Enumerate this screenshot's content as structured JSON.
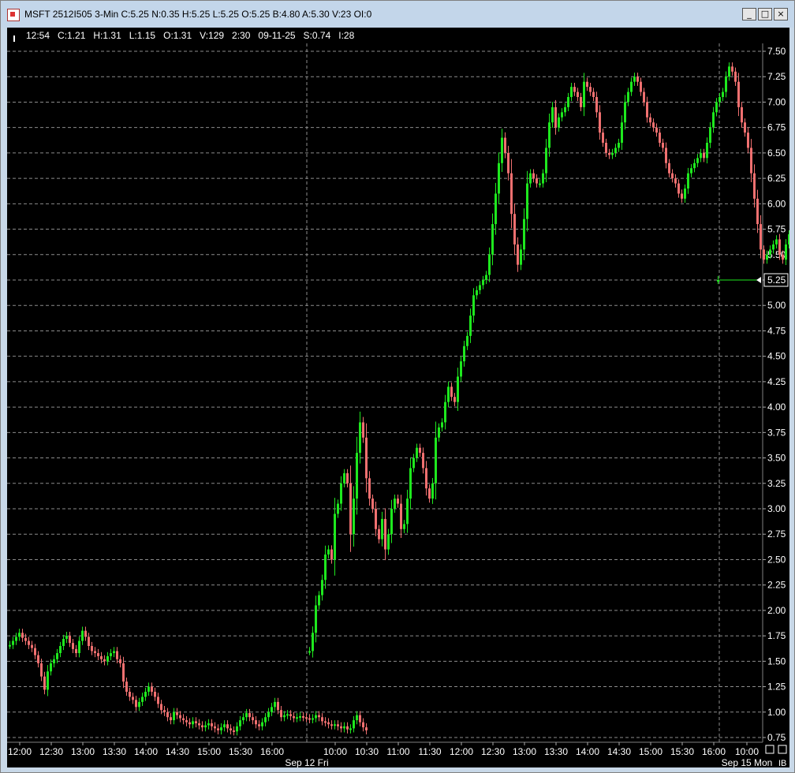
{
  "window": {
    "title": "MSFT 2512I505 3-Min C:5.25 N:0.35 H:5.25 L:5.25 O:5.25 B:4.80 A:5.30 V:23 OI:0",
    "buttons": [
      "_",
      "□",
      "×"
    ]
  },
  "info_bar": {
    "text": "12:54   C:1.21   H:1.31   L:1.15   O:1.31   V:129   2:30   09-11-25   S:0.74   I:28"
  },
  "colors": {
    "up": "#1ee81e",
    "down": "#f07070",
    "grid": "#8c8c8c",
    "axis_text": "#ffffff",
    "background": "#000000"
  },
  "chart_data": {
    "type": "candlestick",
    "y_ticks": [
      "7.50",
      "7.25",
      "7.00",
      "6.75",
      "6.50",
      "6.25",
      "6.00",
      "5.75",
      "5.50",
      "5.25",
      "5.00",
      "4.75",
      "4.50",
      "4.25",
      "4.00",
      "3.75",
      "3.50",
      "3.25",
      "3.00",
      "2.75",
      "2.50",
      "2.25",
      "2.00",
      "1.75",
      "1.50",
      "1.25",
      "1.00",
      "0.75"
    ],
    "ylim": [
      0.75,
      7.5
    ],
    "last_price_label": "5.25",
    "x_ticks": [
      "12:00",
      "12:30",
      "13:00",
      "13:30",
      "14:00",
      "14:30",
      "15:00",
      "15:30",
      "16:00",
      "10:00",
      "10:30",
      "11:00",
      "11:30",
      "12:00",
      "12:30",
      "13:00",
      "13:30",
      "14:00",
      "14:30",
      "15:00",
      "15:30",
      "16:00",
      "10:00"
    ],
    "date_labels": [
      "Sep 12 Fri",
      "Sep 15 Mon"
    ],
    "corner_label": "IB",
    "sessions": [
      {
        "label": "Sep 11",
        "start": "11:48",
        "bar_minutes": 3,
        "close": [
          1.66,
          1.7,
          1.74,
          1.78,
          1.73,
          1.7,
          1.66,
          1.63,
          1.56,
          1.48,
          1.35,
          1.22,
          1.4,
          1.48,
          1.52,
          1.58,
          1.65,
          1.72,
          1.75,
          1.68,
          1.62,
          1.58,
          1.7,
          1.8,
          1.74,
          1.65,
          1.6,
          1.58,
          1.55,
          1.52,
          1.5,
          1.55,
          1.58,
          1.6,
          1.52,
          1.48,
          1.3,
          1.2,
          1.15,
          1.12,
          1.05,
          1.1,
          1.15,
          1.2,
          1.25,
          1.2,
          1.15,
          1.08,
          1.02,
          1.0,
          0.95,
          0.92,
          1.0,
          0.97,
          0.94,
          0.92,
          0.9,
          0.88,
          0.91,
          0.89,
          0.87,
          0.85,
          0.87,
          0.89,
          0.86,
          0.84,
          0.82,
          0.85,
          0.88,
          0.84,
          0.82,
          0.81,
          0.86,
          0.92,
          0.95,
          0.99,
          0.95,
          0.92,
          0.88,
          0.86,
          0.9,
          0.95,
          1.0,
          1.05,
          1.1,
          1.02,
          0.95,
          0.97,
          0.98,
          0.96,
          0.94,
          0.95,
          0.96,
          0.95,
          0.94,
          0.93,
          0.94,
          0.97,
          0.95,
          0.91,
          0.9,
          0.88,
          0.87,
          0.88,
          0.86,
          0.84,
          0.86,
          0.83,
          0.84,
          0.92,
          0.97,
          0.9,
          0.85,
          0.82
        ]
      },
      {
        "label": "Sep 12 Fri",
        "start": "09:33",
        "bar_minutes": 3,
        "close": [
          1.6,
          1.78,
          2.05,
          2.15,
          2.3,
          2.55,
          2.6,
          2.5,
          2.95,
          3.05,
          3.25,
          3.35,
          3.25,
          2.75,
          3.1,
          3.55,
          3.85,
          3.7,
          3.3,
          3.1,
          3.0,
          2.8,
          2.7,
          2.9,
          2.6,
          2.75,
          3.0,
          3.1,
          3.05,
          2.8,
          2.85,
          3.1,
          3.4,
          3.5,
          3.6,
          3.55,
          3.4,
          3.2,
          3.1,
          3.25,
          3.7,
          3.8,
          3.85,
          4.05,
          4.2,
          4.1,
          4.05,
          4.3,
          4.45,
          4.6,
          4.7,
          4.9,
          5.1,
          5.15,
          5.2,
          5.25,
          5.3,
          5.5,
          5.8,
          6.1,
          6.4,
          6.65,
          6.5,
          6.3,
          5.9,
          5.6,
          5.4,
          5.55,
          5.85,
          6.2,
          6.3,
          6.25,
          6.2,
          6.2,
          6.3,
          6.55,
          6.8,
          6.95,
          6.75,
          6.85,
          6.9,
          6.95,
          7.05,
          7.15,
          7.1,
          7.05,
          6.95,
          7.2,
          7.15,
          7.1,
          7.05,
          6.9,
          6.7,
          6.6,
          6.5,
          6.48,
          6.5,
          6.55,
          6.6,
          6.8,
          7.0,
          7.1,
          7.2,
          7.25,
          7.2,
          7.1,
          7.0,
          6.85,
          6.8,
          6.75,
          6.7,
          6.6,
          6.55,
          6.4,
          6.3,
          6.25,
          6.2,
          6.1,
          6.05,
          6.15,
          6.3,
          6.35,
          6.4,
          6.45,
          6.5,
          6.45,
          6.6,
          6.75,
          6.9,
          7.0,
          7.05,
          7.1,
          7.25,
          7.35,
          7.3,
          7.2,
          6.95,
          6.8,
          6.7,
          6.55,
          6.3,
          6.05,
          5.8,
          5.55,
          5.45,
          5.5,
          5.55,
          5.6,
          5.65,
          5.5,
          5.45,
          5.6,
          5.7,
          5.8,
          5.85,
          5.6,
          5.5,
          5.45
        ]
      },
      {
        "label": "Sep 15 Mon",
        "start": "09:30",
        "bar_minutes": 3,
        "close": [
          5.25
        ]
      }
    ]
  }
}
